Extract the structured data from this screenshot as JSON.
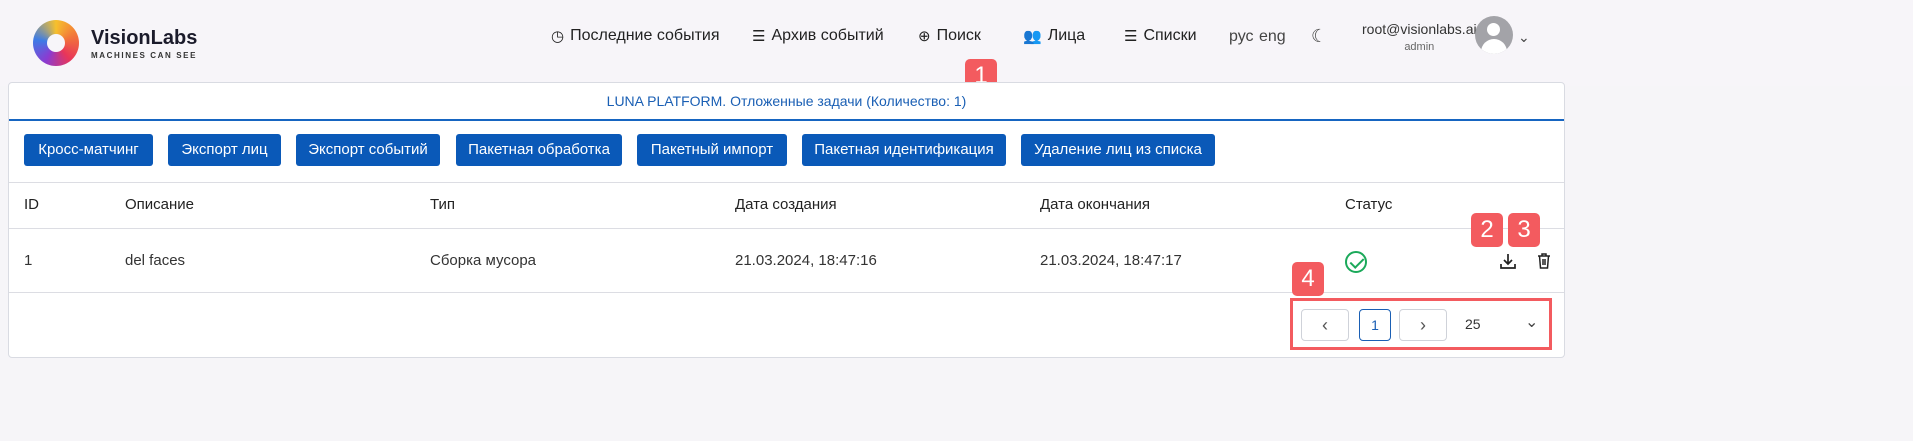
{
  "brand": {
    "name": "VisionLabs",
    "tagline": "MACHINES CAN SEE"
  },
  "nav": [
    {
      "label": "Последние события",
      "icon": "clock-icon"
    },
    {
      "label": "Архив событий",
      "icon": "list-icon"
    },
    {
      "label": "Поиск",
      "icon": "crosshair-icon"
    },
    {
      "label": "Лица",
      "icon": "people-icon"
    },
    {
      "label": "Списки",
      "icon": "list-icon"
    }
  ],
  "languages": [
    "рус",
    "eng"
  ],
  "user": {
    "email": "root@visionlabs.ai",
    "role": "admin"
  },
  "panel": {
    "title": "LUNA PLATFORM. Отложенные задачи (Количество: 1)"
  },
  "actions": [
    "Кросс-матчинг",
    "Экспорт лиц",
    "Экспорт событий",
    "Пакетная обработка",
    "Пакетный импорт",
    "Пакетная идентификация",
    "Удаление лиц из списка"
  ],
  "table": {
    "columns": [
      "ID",
      "Описание",
      "Тип",
      "Дата создания",
      "Дата окончания",
      "Статус"
    ],
    "rows": [
      {
        "id": "1",
        "description": "del faces",
        "type": "Сборка мусора",
        "created": "21.03.2024, 18:47:16",
        "finished": "21.03.2024, 18:47:17",
        "status": "done"
      }
    ]
  },
  "pagination": {
    "current": "1",
    "page_size": "25"
  },
  "callouts": [
    "1",
    "2",
    "3",
    "4"
  ],
  "colors": {
    "primary": "#0a59b8",
    "callout": "#f35b5f",
    "success": "#1ba95a"
  }
}
